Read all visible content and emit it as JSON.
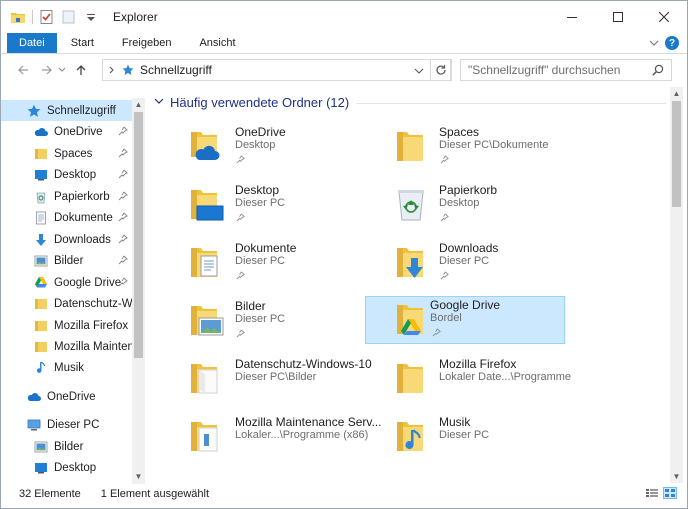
{
  "titlebar": {
    "title": "Explorer"
  },
  "ribbon": {
    "tabs": [
      "Datei",
      "Start",
      "Freigeben",
      "Ansicht"
    ]
  },
  "address": {
    "path": "Schnellzugriff"
  },
  "search": {
    "placeholder": "\"Schnellzugriff\" durchsuchen"
  },
  "nav": {
    "items": [
      {
        "label": "Schnellzugriff",
        "icon": "star-icon"
      },
      {
        "label": "OneDrive",
        "icon": "cloud-icon"
      },
      {
        "label": "Spaces",
        "icon": "folder-icon"
      },
      {
        "label": "Desktop",
        "icon": "desktop-icon"
      },
      {
        "label": "Papierkorb",
        "icon": "recycle-bin-icon"
      },
      {
        "label": "Dokumente",
        "icon": "document-icon"
      },
      {
        "label": "Downloads",
        "icon": "download-icon"
      },
      {
        "label": "Bilder",
        "icon": "picture-icon"
      },
      {
        "label": "Google Drive",
        "icon": "google-drive-icon"
      },
      {
        "label": "Datenschutz-Wir",
        "icon": "folder-icon"
      },
      {
        "label": "Mozilla Firefox",
        "icon": "folder-icon"
      },
      {
        "label": "Mozilla Mainten",
        "icon": "folder-icon"
      },
      {
        "label": "Musik",
        "icon": "music-icon"
      },
      {
        "label": "OneDrive",
        "icon": "cloud-icon"
      },
      {
        "label": "Dieser PC",
        "icon": "computer-icon"
      },
      {
        "label": "Bilder",
        "icon": "picture-icon"
      },
      {
        "label": "Desktop",
        "icon": "desktop-icon"
      }
    ]
  },
  "content": {
    "group_title": "Häufig verwendete Ordner (12)",
    "tiles": [
      {
        "name": "OneDrive",
        "location": "Desktop",
        "icon": "onedrive-folder-icon"
      },
      {
        "name": "Spaces",
        "location": "Dieser PC\\Dokumente",
        "icon": "folder-icon"
      },
      {
        "name": "Desktop",
        "location": "Dieser PC",
        "icon": "desktop-folder-icon"
      },
      {
        "name": "Papierkorb",
        "location": "Desktop",
        "icon": "recycle-bin-icon"
      },
      {
        "name": "Dokumente",
        "location": "Dieser PC",
        "icon": "documents-folder-icon"
      },
      {
        "name": "Downloads",
        "location": "Dieser PC",
        "icon": "downloads-folder-icon"
      },
      {
        "name": "Bilder",
        "location": "Dieser PC",
        "icon": "pictures-folder-icon"
      },
      {
        "name": "Google Drive",
        "location": "Bordel",
        "icon": "google-drive-folder-icon"
      },
      {
        "name": "Datenschutz-Windows-10",
        "location": "Dieser PC\\Bilder",
        "icon": "white-folder-icon"
      },
      {
        "name": "Mozilla Firefox",
        "location": "Lokaler Date...\\Programme",
        "icon": "folder-icon"
      },
      {
        "name": "Mozilla Maintenance Serv...",
        "location": "Lokaler...\\Programme (x86)",
        "icon": "white-folder-icon"
      },
      {
        "name": "Musik",
        "location": "Dieser PC",
        "icon": "music-folder-icon"
      }
    ]
  },
  "status": {
    "count": "32 Elemente",
    "selection": "1 Element ausgewählt"
  }
}
